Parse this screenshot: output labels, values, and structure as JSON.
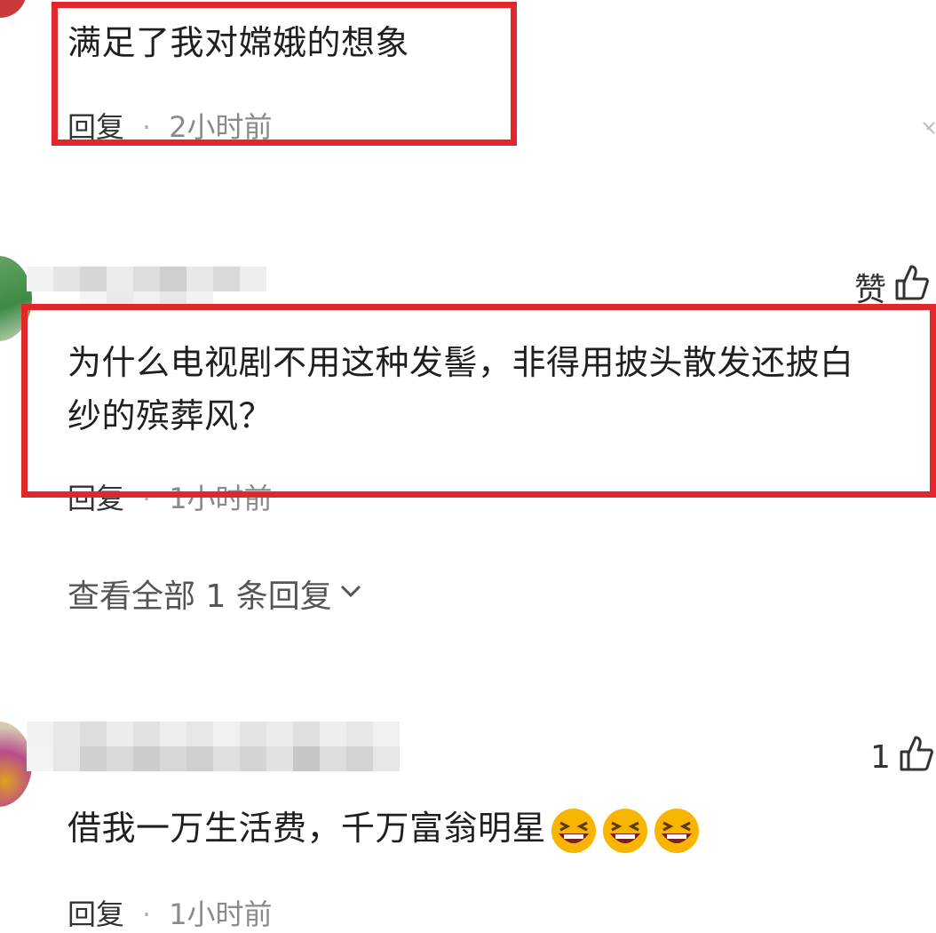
{
  "comments": [
    {
      "text": "满足了我对嫦娥的想象",
      "reply_label": "回复",
      "separator": "·",
      "time": "2小时前"
    },
    {
      "like_label": "赞",
      "text_line1": "为什么电视剧不用这种发髻，非得用披头散发还披白",
      "text_line2": "纱的殡葬风？",
      "reply_label": "回复",
      "separator": "·",
      "time": "1小时前",
      "view_replies": "查看全部 1 条回复"
    },
    {
      "like_count": "1",
      "text": "借我一万生活费，千万富翁明星",
      "reply_label": "回复",
      "separator": "·",
      "time": "1小时前"
    }
  ],
  "colors": {
    "highlight_red": "#e3262b",
    "meta_gray": "#8a8a8a"
  },
  "icons": [
    "thumbs-up-icon",
    "chevron-down-icon",
    "laughing-emoji-icon",
    "close-icon"
  ]
}
